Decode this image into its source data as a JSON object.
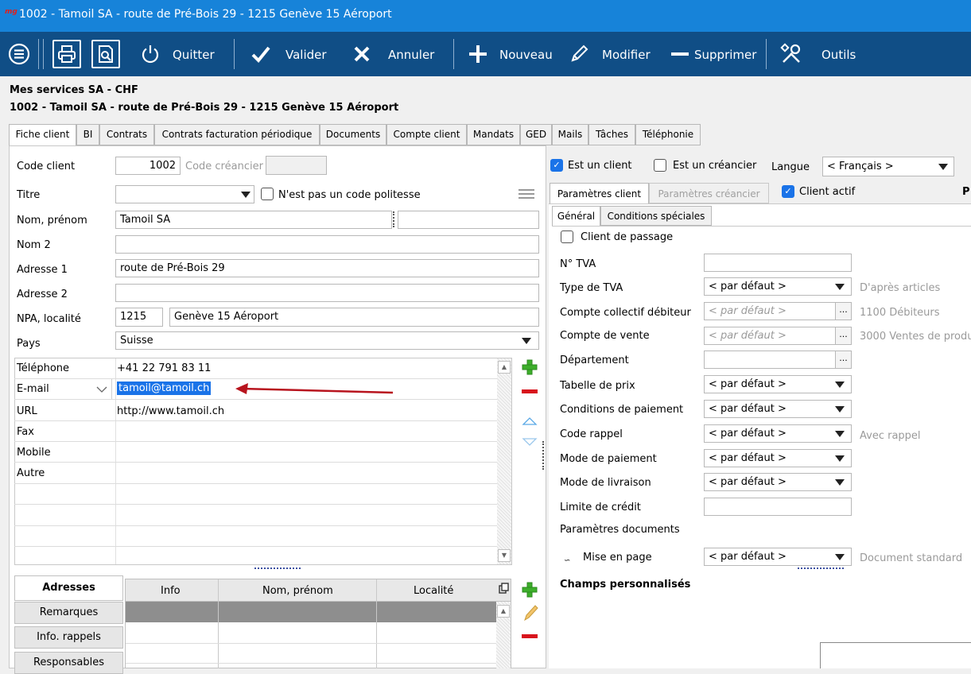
{
  "window": {
    "logo": "mg",
    "title": "1002 - Tamoil SA - route de Pré-Bois 29 - 1215 Genève 15 Aéroport"
  },
  "toolbar": {
    "quitter": "Quitter",
    "valider": "Valider",
    "annuler": "Annuler",
    "nouveau": "Nouveau",
    "modifier": "Modifier",
    "supprimer": "Supprimer",
    "outils": "Outils"
  },
  "header": {
    "company": "Mes services SA  -  CHF",
    "client": "1002 - Tamoil SA - route de Pré-Bois 29 - 1215 Genève 15 Aéroport"
  },
  "tabs": [
    "Fiche client",
    "BI",
    "Contrats",
    "Contrats facturation périodique",
    "Documents",
    "Compte client",
    "Mandats",
    "GED",
    "Mails",
    "Tâches",
    "Téléphonie"
  ],
  "form": {
    "code_client_label": "Code client",
    "code_client_value": "1002",
    "code_creancier_label": "Code créancier",
    "titre_label": "Titre",
    "politesse_label": "N'est pas un code politesse",
    "nom_label": "Nom, prénom",
    "nom_value": "Tamoil SA",
    "nom2_label": "Nom 2",
    "adresse1_label": "Adresse 1",
    "adresse1_value": "route de Pré-Bois 29",
    "adresse2_label": "Adresse 2",
    "npa_label": "NPA, localité",
    "npa_value": "1215",
    "localite_value": "Genève 15 Aéroport",
    "pays_label": "Pays",
    "pays_value": "Suisse"
  },
  "contacts": [
    {
      "type": "Téléphone",
      "value": "+41 22 791 83 11"
    },
    {
      "type": "E-mail",
      "value": "tamoil@tamoil.ch"
    },
    {
      "type": "URL",
      "value": "http://www.tamoil.ch"
    },
    {
      "type": "Fax",
      "value": ""
    },
    {
      "type": "Mobile",
      "value": ""
    },
    {
      "type": "Autre",
      "value": ""
    }
  ],
  "bottom": {
    "adresses": "Adresses",
    "remarques": "Remarques",
    "info_rappels": "Info. rappels",
    "responsables": "Responsables",
    "col_info": "Info",
    "col_nom": "Nom, prénom",
    "col_localite": "Localité"
  },
  "right": {
    "est_client": "Est un client",
    "est_creancier": "Est un créancier",
    "langue_label": "Langue",
    "langue_value": "< Français >",
    "tab_param_client": "Paramètres client",
    "tab_param_creancier": "Paramètres créancier",
    "client_actif": "Client actif",
    "edge_letter": "P",
    "subtab_general": "Général",
    "subtab_conditions": "Conditions spéciales",
    "client_passage": "Client de passage",
    "tva_label": "N° TVA",
    "type_tva_label": "Type de TVA",
    "type_tva_value": "< par défaut >",
    "type_tva_info": "D'après articles",
    "compte_coll_label": "Compte collectif débiteur",
    "compte_coll_value": "< par défaut >",
    "compte_coll_info": "1100 Débiteurs",
    "compte_vente_label": "Compte  de vente",
    "compte_vente_value": "< par défaut >",
    "compte_vente_info": "3000 Ventes de produ",
    "departement_label": "Département",
    "tabelle_label": "Tabelle de prix",
    "tabelle_value": "< par défaut >",
    "conditions_label": "Conditions de paiement",
    "conditions_value": "< par défaut >",
    "code_rappel_label": "Code rappel",
    "code_rappel_value": "< par défaut >",
    "code_rappel_info": "Avec rappel",
    "mode_paiement_label": "Mode de paiement",
    "mode_paiement_value": "< par défaut >",
    "mode_livraison_label": "Mode de livraison",
    "mode_livraison_value": "< par défaut >",
    "limite_label": "Limite de crédit",
    "param_docs_label": "Paramètres documents",
    "mise_page_label": "Mise en page",
    "mise_page_value": "< par défaut >",
    "mise_page_info": "Document standard",
    "champs_label": "Champs personnalisés"
  }
}
